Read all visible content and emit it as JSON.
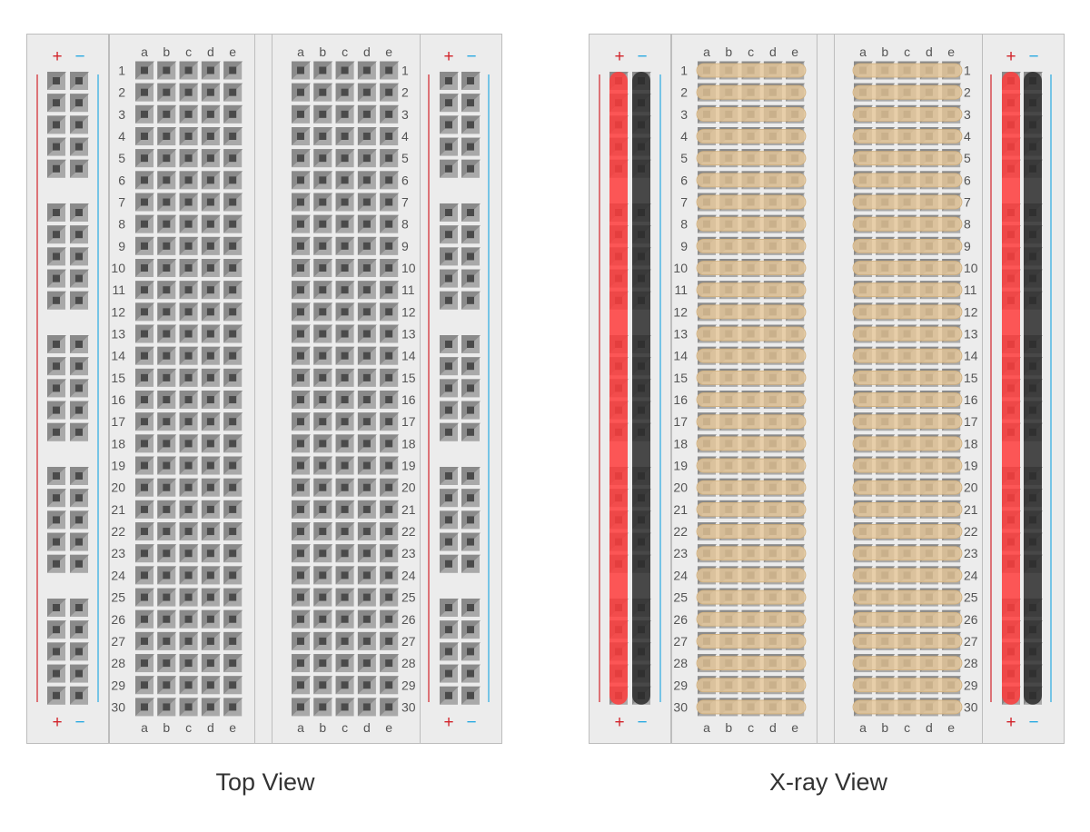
{
  "views": [
    {
      "id": "top",
      "title": "Top View",
      "mode": "top"
    },
    {
      "id": "xray",
      "title": "X-ray View",
      "mode": "xray"
    }
  ],
  "breadboard": {
    "rows": 30,
    "columns_left": [
      "a",
      "b",
      "c",
      "d",
      "e"
    ],
    "columns_right": [
      "a",
      "b",
      "c",
      "d",
      "e"
    ],
    "rail_symbols": {
      "plus": "+",
      "minus": "−"
    },
    "rail_group_size": 5,
    "rail_group_count": 5
  },
  "colors": {
    "board": "#ececec",
    "board_border": "#bdbdbd",
    "socket_light": "#a9a9a9",
    "socket_dark": "#8a8a8a",
    "socket_hole": "#4a4a4a",
    "plus": "#d2232a",
    "minus": "#27a9e1",
    "strip_fill": "#e5c79a",
    "strip_edge": "#cfae7c",
    "rail_plus_strip": "#ff3c3c",
    "rail_minus_strip": "#2c2c2c"
  }
}
